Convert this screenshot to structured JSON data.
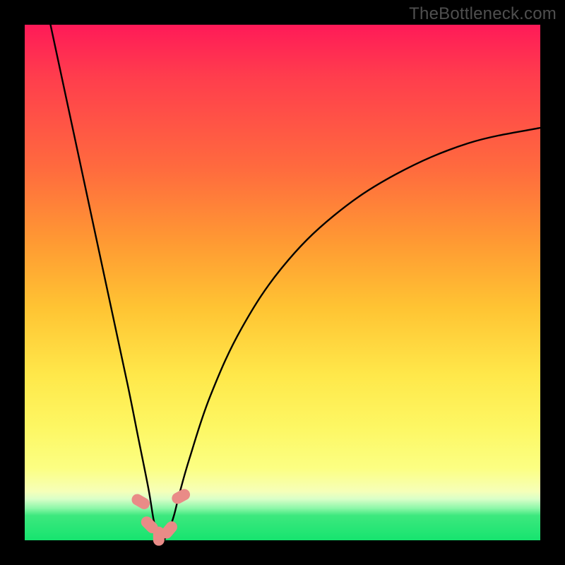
{
  "watermark": "TheBottleneck.com",
  "colors": {
    "frame": "#000000",
    "curve": "#000000",
    "marker": "#e98b87"
  },
  "chart_data": {
    "type": "line",
    "title": "",
    "xlabel": "",
    "ylabel": "",
    "xlim": [
      0,
      100
    ],
    "ylim": [
      0,
      100
    ],
    "grid": false,
    "description": "V-shaped bottleneck curve over red-to-green vertical gradient; minimum (optimal) near x≈26, y≈0. Left branch is steep, right branch is gentler.",
    "series": [
      {
        "name": "bottleneck-curve",
        "x": [
          5,
          8,
          11,
          14,
          17,
          20,
          22,
          24,
          25,
          26,
          27,
          28,
          29,
          30,
          32,
          36,
          42,
          50,
          60,
          72,
          86,
          100
        ],
        "y": [
          100,
          86,
          72,
          58,
          44,
          30,
          20,
          10,
          4,
          0,
          0,
          2,
          5,
          9,
          16,
          28,
          41,
          53,
          63,
          71,
          77,
          80
        ]
      }
    ],
    "markers": {
      "name": "optimal-zone-markers",
      "points": [
        {
          "x": 22.5,
          "y": 7.5,
          "angle": -60
        },
        {
          "x": 24.2,
          "y": 3.0,
          "angle": -45
        },
        {
          "x": 26.0,
          "y": 0.8,
          "angle": 0
        },
        {
          "x": 28.0,
          "y": 2.0,
          "angle": 40
        },
        {
          "x": 30.3,
          "y": 8.5,
          "angle": 62
        }
      ]
    }
  }
}
